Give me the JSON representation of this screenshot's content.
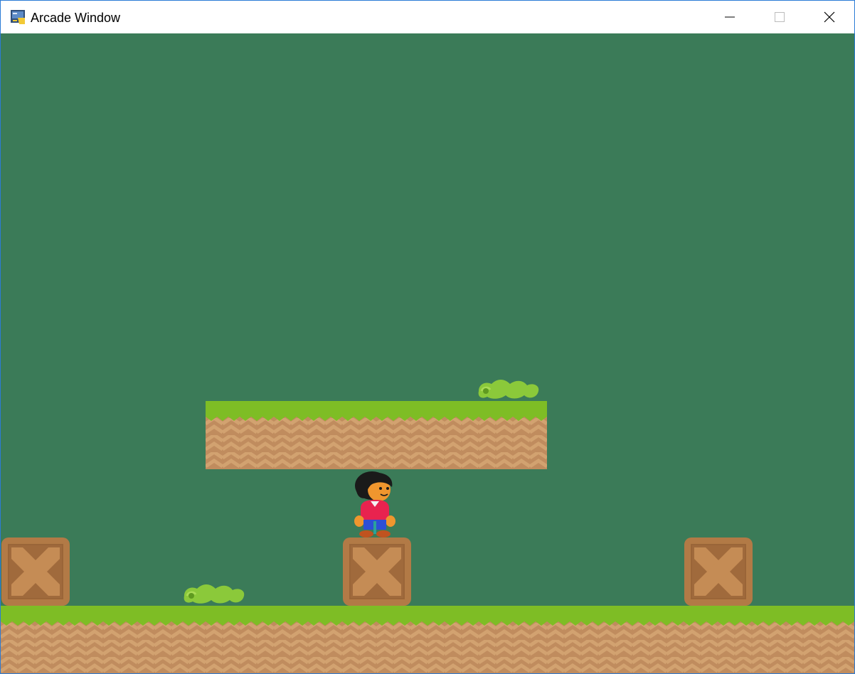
{
  "window": {
    "title": "Arcade Window",
    "icon": "python-arcade-app-icon",
    "controls": [
      "minimize-icon",
      "maximize-icon",
      "close-icon"
    ]
  },
  "scene": {
    "background_color": "#3b7b58",
    "grass_color": "#7ebd25",
    "dirt_color": "#c08c5e",
    "crate_color": "#b27a46",
    "slime_color": "#8bc93a",
    "sprites": [
      "player",
      "slime",
      "slime",
      "crate",
      "crate",
      "crate",
      "floating-platform",
      "ground"
    ]
  }
}
